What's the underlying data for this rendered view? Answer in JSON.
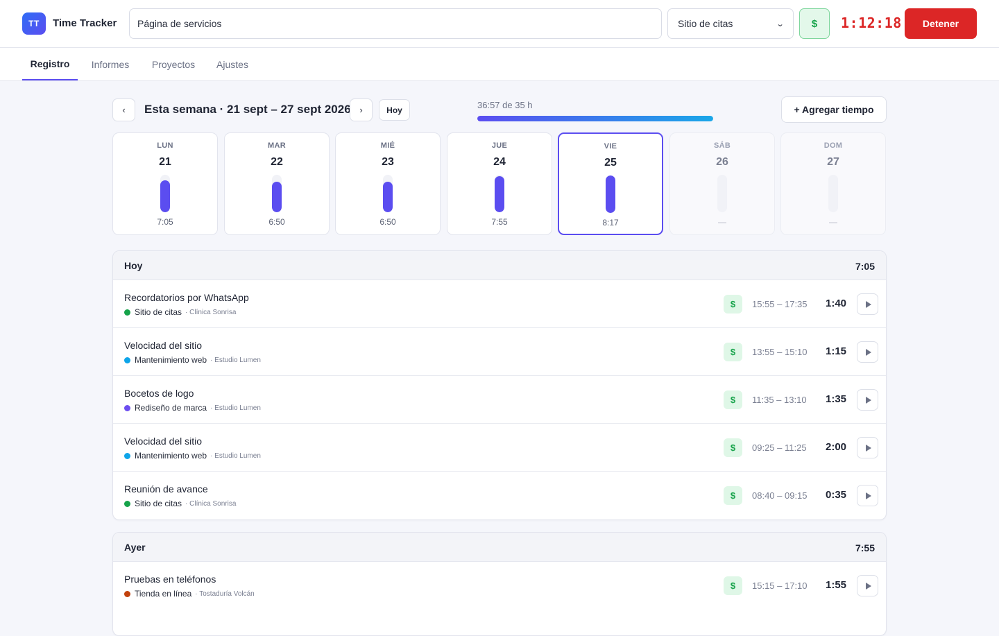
{
  "app": {
    "logo": "TT",
    "title": "Time Tracker"
  },
  "header": {
    "task_value": "Página de servicios",
    "project_selected": "Sitio de citas",
    "billable_symbol": "$",
    "timer": "1:12:18",
    "stop_label": "Detener"
  },
  "tabs": [
    {
      "label": "Registro",
      "active": true
    },
    {
      "label": "Informes",
      "active": false
    },
    {
      "label": "Proyectos",
      "active": false
    },
    {
      "label": "Ajustes",
      "active": false
    }
  ],
  "week": {
    "prev_symbol": "‹",
    "next_symbol": "›",
    "title": "Esta semana · 21 sept – 27 sept 2026",
    "today_label": "Hoy",
    "progress_label": "36:57 de 35 h",
    "progress_fraction": 1.0,
    "add_label": "+ Agregar tiempo"
  },
  "days": [
    {
      "name": "LUN",
      "num": "21",
      "total": "7:05",
      "fill": 0.85,
      "selected": false,
      "weekend": false
    },
    {
      "name": "MAR",
      "num": "22",
      "total": "6:50",
      "fill": 0.82,
      "selected": false,
      "weekend": false
    },
    {
      "name": "MIÉ",
      "num": "23",
      "total": "6:50",
      "fill": 0.82,
      "selected": false,
      "weekend": false
    },
    {
      "name": "JUE",
      "num": "24",
      "total": "7:55",
      "fill": 0.96,
      "selected": false,
      "weekend": false
    },
    {
      "name": "VIE",
      "num": "25",
      "total": "8:17",
      "fill": 1.0,
      "selected": true,
      "weekend": false
    },
    {
      "name": "SÁB",
      "num": "26",
      "total": "—",
      "fill": 0,
      "selected": false,
      "weekend": true
    },
    {
      "name": "DOM",
      "num": "27",
      "total": "—",
      "fill": 0,
      "selected": false,
      "weekend": true
    }
  ],
  "groups": [
    {
      "label": "Hoy",
      "total": "7:05",
      "entries": [
        {
          "title": "Recordatorios por WhatsApp",
          "project": "Sitio de citas",
          "client": "· Clínica Sonrisa",
          "color": "#16a34a",
          "billable": "$",
          "range": "15:55 – 17:35",
          "duration": "1:40"
        },
        {
          "title": "Velocidad del sitio",
          "project": "Mantenimiento web",
          "client": "· Estudio Lumen",
          "color": "#0ea5e9",
          "billable": "$",
          "range": "13:55 – 15:10",
          "duration": "1:15"
        },
        {
          "title": "Bocetos de logo",
          "project": "Rediseño de marca",
          "client": "· Estudio Lumen",
          "color": "#6d4ef0",
          "billable": "$",
          "range": "11:35 – 13:10",
          "duration": "1:35"
        },
        {
          "title": "Velocidad del sitio",
          "project": "Mantenimiento web",
          "client": "· Estudio Lumen",
          "color": "#0ea5e9",
          "billable": "$",
          "range": "09:25 – 11:25",
          "duration": "2:00"
        },
        {
          "title": "Reunión de avance",
          "project": "Sitio de citas",
          "client": "· Clínica Sonrisa",
          "color": "#16a34a",
          "billable": "$",
          "range": "08:40 – 09:15",
          "duration": "0:35"
        }
      ]
    },
    {
      "label": "Ayer",
      "total": "7:55",
      "entries": [
        {
          "title": "Pruebas en teléfonos",
          "project": "Tienda en línea",
          "client": "· Tostaduría Volcán",
          "color": "#c2410c",
          "billable": "$",
          "range": "15:15 – 17:10",
          "duration": "1:55"
        }
      ]
    }
  ]
}
